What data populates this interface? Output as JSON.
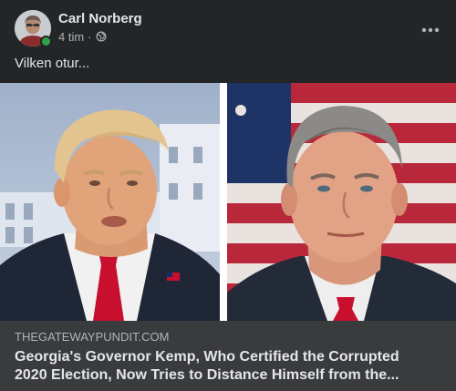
{
  "post": {
    "author": "Carl Norberg",
    "time": "4 tim",
    "separator": "·",
    "privacy_icon": "globe-icon",
    "more_icon": "more-dots-icon",
    "text": "Vilken otur...",
    "author_online": true
  },
  "link_card": {
    "domain": "THEGATEWAYPUNDIT.COM",
    "title_line1": "Georgia's Governor Kemp, Who Certified the Corrupted",
    "title_line2": "2020 Election, Now Tries to Distance Himself from the..."
  },
  "colors": {
    "background": "#242526",
    "card_info": "#3a3b3c",
    "primary_text": "#e4e6eb",
    "secondary_text": "#b0b3b8",
    "online_status": "#31a24c"
  }
}
